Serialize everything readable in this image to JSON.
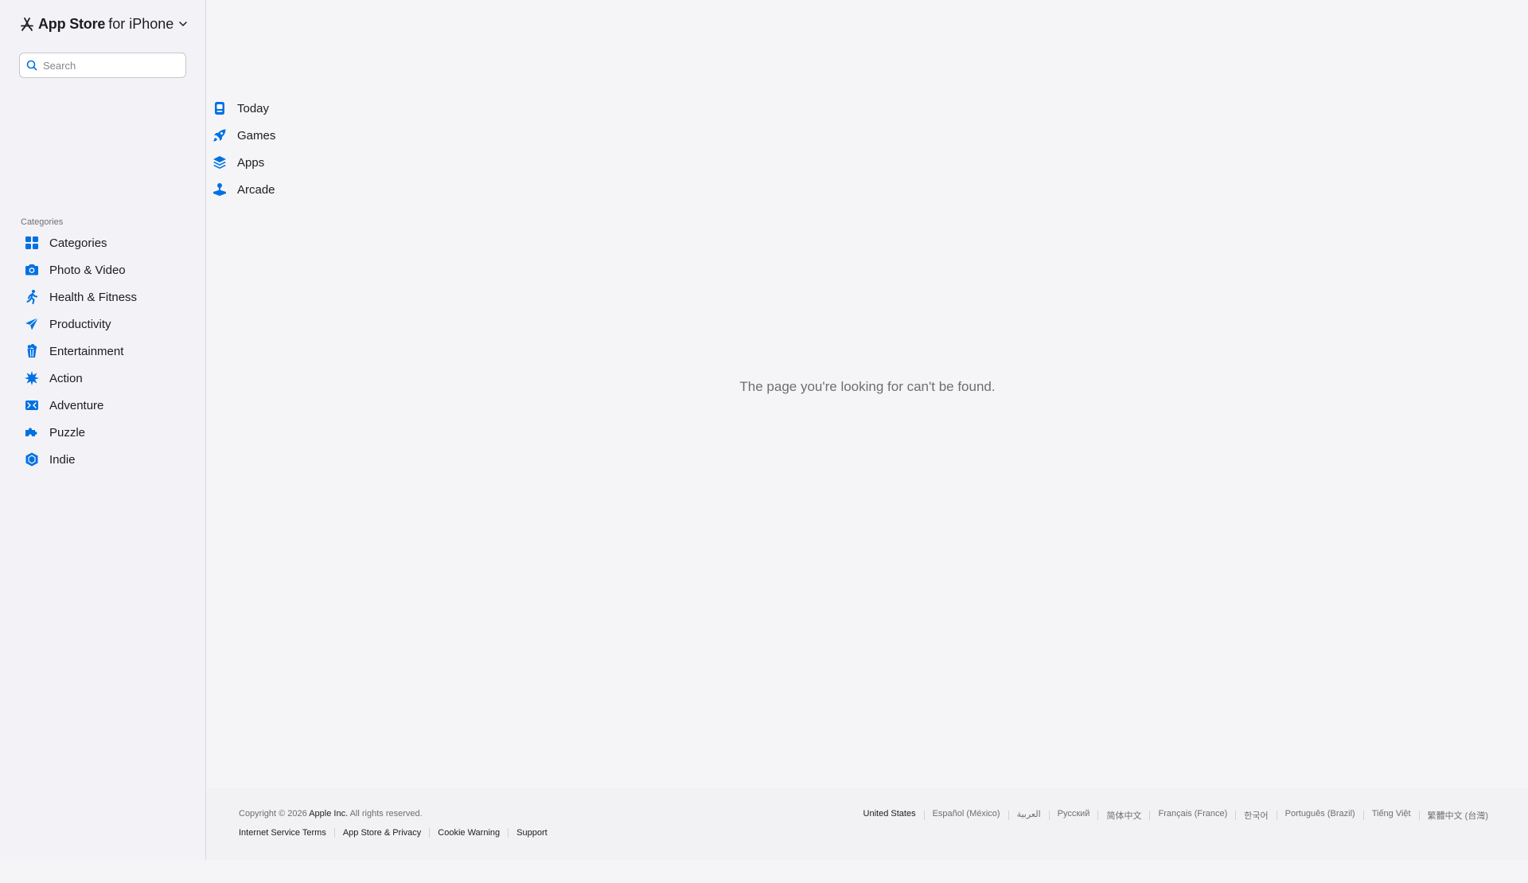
{
  "header": {
    "app_store": "App Store",
    "platform": "for iPhone"
  },
  "search": {
    "placeholder": "Search",
    "value": ""
  },
  "nav": {
    "items": [
      {
        "label": "Today",
        "icon": "today-icon"
      },
      {
        "label": "Games",
        "icon": "rocket-icon"
      },
      {
        "label": "Apps",
        "icon": "layers-icon"
      },
      {
        "label": "Arcade",
        "icon": "joystick-icon"
      }
    ]
  },
  "categories": {
    "heading": "Categories",
    "items": [
      {
        "label": "Categories",
        "icon": "grid-icon"
      },
      {
        "label": "Photo & Video",
        "icon": "camera-icon"
      },
      {
        "label": "Health & Fitness",
        "icon": "running-figure-icon"
      },
      {
        "label": "Productivity",
        "icon": "paper-plane-icon"
      },
      {
        "label": "Entertainment",
        "icon": "popcorn-icon"
      },
      {
        "label": "Action",
        "icon": "burst-icon"
      },
      {
        "label": "Adventure",
        "icon": "map-icon"
      },
      {
        "label": "Puzzle",
        "icon": "puzzle-piece-icon"
      },
      {
        "label": "Indie",
        "icon": "hexagon-icon"
      }
    ]
  },
  "main": {
    "message": "The page you're looking for can't be found."
  },
  "footer": {
    "copyright_prefix": "Copyright © 2026 ",
    "company": "Apple Inc.",
    "copyright_suffix": " All rights reserved.",
    "links": [
      "Internet Service Terms",
      "App Store & Privacy",
      "Cookie Warning",
      "Support"
    ],
    "languages": [
      "United States",
      "Español (México)",
      "العربية",
      "Русский",
      "简体中文",
      "Français (France)",
      "한국어",
      "Português (Brazil)",
      "Tiếng Việt",
      "繁體中文 (台灣)"
    ]
  },
  "colors": {
    "accent": "#0071e3",
    "sidebar_bg": "#f2f2f7",
    "page_bg": "#f5f5f7"
  }
}
